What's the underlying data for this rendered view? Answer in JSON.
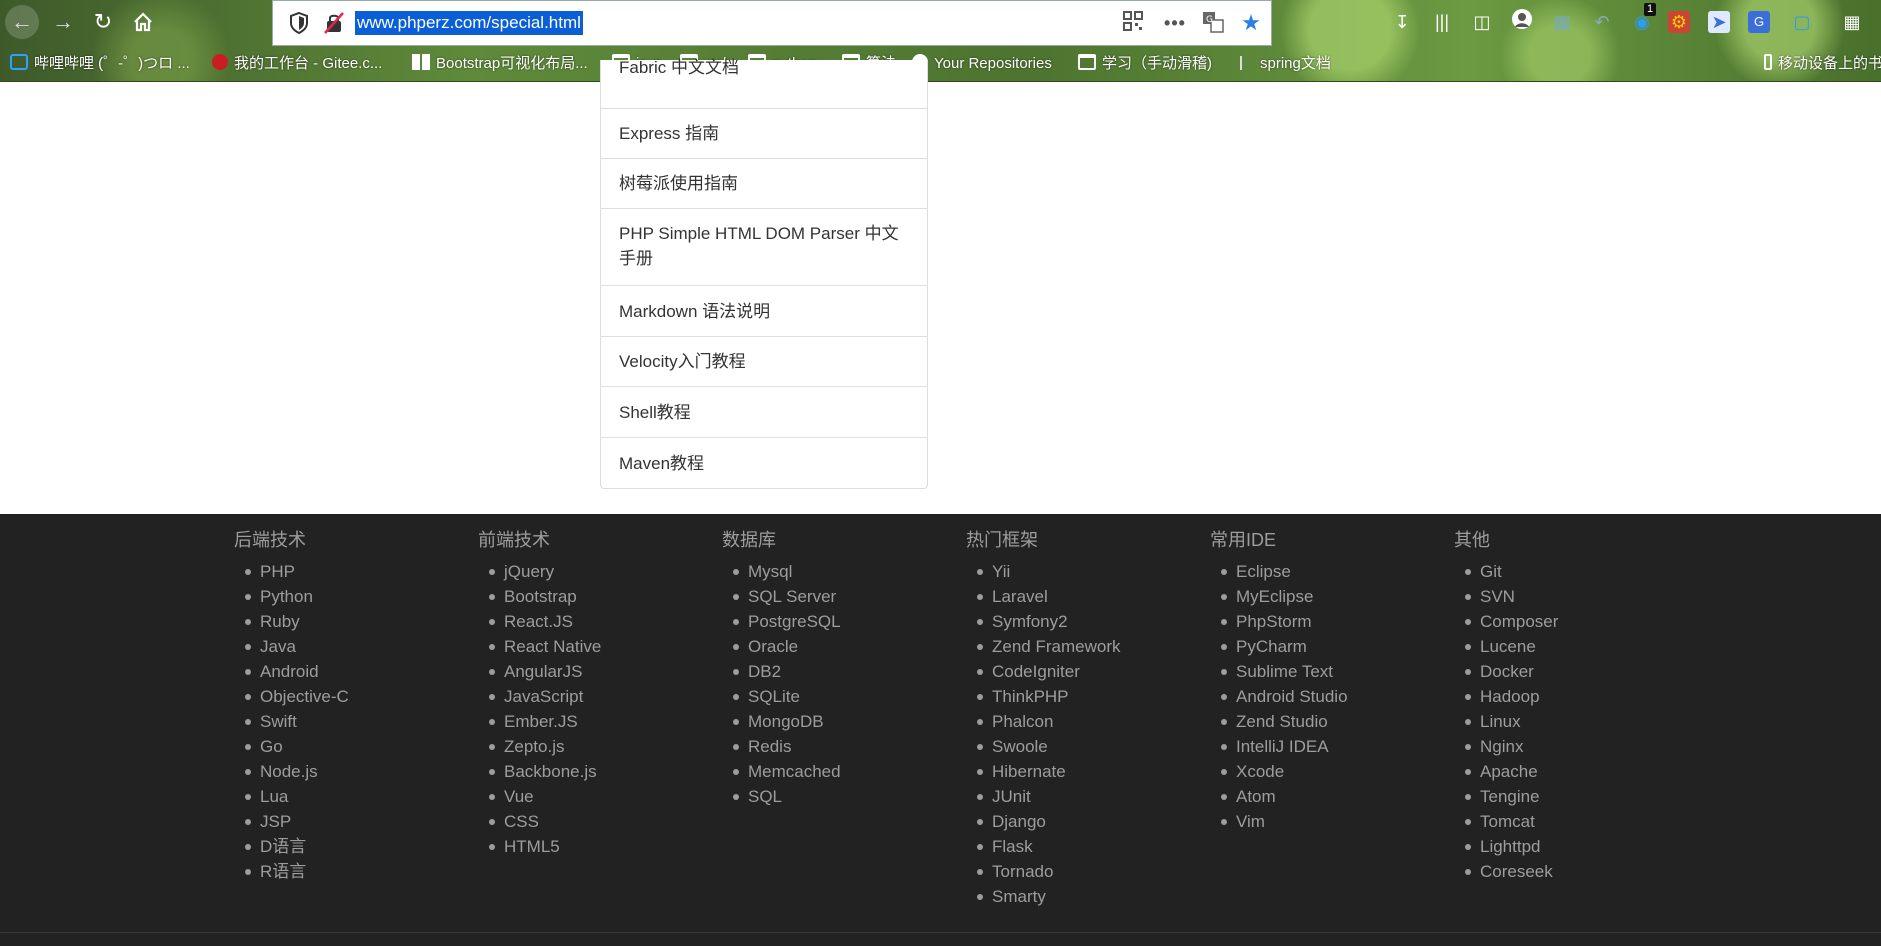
{
  "browser": {
    "url": "www.phperz.com/special.html",
    "bookmarks": [
      {
        "label": "哔哩哔哩 (゜-゜)つロ ...",
        "icon": "bilibili-icon"
      },
      {
        "label": "我的工作台 - Gitee.c...",
        "icon": "gitee-icon"
      },
      {
        "label": "Bootstrap可视化布局...",
        "icon": "bootstrap-grid-icon"
      },
      {
        "label": "java",
        "icon": "folder-icon"
      },
      {
        "label": "web",
        "icon": "folder-icon"
      },
      {
        "label": "python",
        "icon": "folder-icon"
      },
      {
        "label": "算法",
        "icon": "folder-icon"
      },
      {
        "label": "Your Repositories",
        "icon": "github-icon"
      },
      {
        "label": "学习（手动滑稽)",
        "icon": "folder-icon"
      },
      {
        "label": "spring文档",
        "icon": "spring-icon"
      },
      {
        "label": "移动设备上的书",
        "icon": "mobile-icon"
      }
    ],
    "toolbar_badge": "1"
  },
  "list": {
    "items": [
      "Fabric 中文文档",
      "Express 指南",
      "树莓派使用指南",
      "PHP Simple HTML DOM Parser 中文手册",
      "Markdown 语法说明",
      "Velocity入门教程",
      "Shell教程",
      "Maven教程"
    ]
  },
  "footer": {
    "columns": [
      {
        "title": "后端技术",
        "items": [
          "PHP",
          "Python",
          "Ruby",
          "Java",
          "Android",
          "Objective-C",
          "Swift",
          "Go",
          "Node.js",
          "Lua",
          "JSP",
          "D语言",
          "R语言"
        ]
      },
      {
        "title": "前端技术",
        "items": [
          "jQuery",
          "Bootstrap",
          "React.JS",
          "React Native",
          "AngularJS",
          "JavaScript",
          "Ember.JS",
          "Zepto.js",
          "Backbone.js",
          "Vue",
          "CSS",
          "HTML5"
        ]
      },
      {
        "title": "数据库",
        "items": [
          "Mysql",
          "SQL Server",
          "PostgreSQL",
          "Oracle",
          "DB2",
          "SQLite",
          "MongoDB",
          "Redis",
          "Memcached",
          "SQL"
        ]
      },
      {
        "title": "热门框架",
        "items": [
          "Yii",
          "Laravel",
          "Symfony2",
          "Zend Framework",
          "CodeIgniter",
          "ThinkPHP",
          "Phalcon",
          "Swoole",
          "Hibernate",
          "JUnit",
          "Django",
          "Flask",
          "Tornado",
          "Smarty"
        ]
      },
      {
        "title": "常用IDE",
        "items": [
          "Eclipse",
          "MyEclipse",
          "PhpStorm",
          "PyCharm",
          "Sublime Text",
          "Android Studio",
          "Zend Studio",
          "IntelliJ IDEA",
          "Xcode",
          "Atom",
          "Vim"
        ]
      },
      {
        "title": "其他",
        "items": [
          "Git",
          "SVN",
          "Composer",
          "Lucene",
          "Docker",
          "Hadoop",
          "Linux",
          "Nginx",
          "Apache",
          "Tengine",
          "Tomcat",
          "Lighttpd",
          "Coreseek"
        ]
      }
    ]
  },
  "colors": {
    "footer_bg": "#222222",
    "footer_text": "#9d9d9d",
    "url_highlight": "#0a5fd6",
    "border": "#dddddd"
  }
}
